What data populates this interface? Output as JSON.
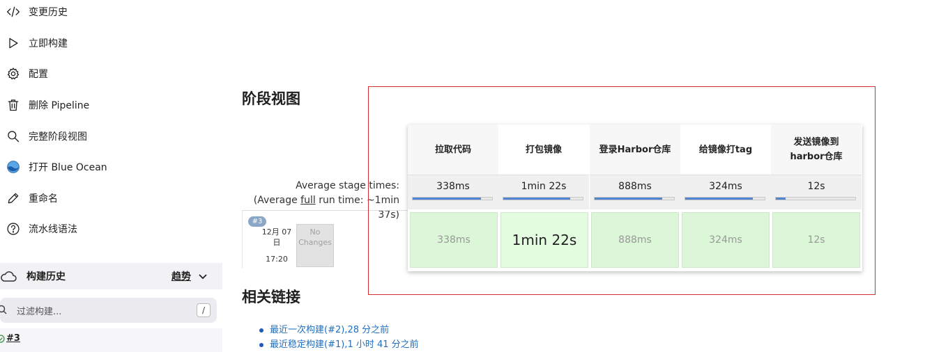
{
  "sidebar": {
    "items": [
      {
        "label": "变更历史",
        "icon": "code-icon"
      },
      {
        "label": "立即构建",
        "icon": "play-icon"
      },
      {
        "label": "配置",
        "icon": "gear-icon"
      },
      {
        "label": "删除 Pipeline",
        "icon": "trash-icon"
      },
      {
        "label": "完整阶段视图",
        "icon": "search-icon"
      },
      {
        "label": "打开 Blue Ocean",
        "icon": "blue-ocean-icon"
      },
      {
        "label": "重命名",
        "icon": "pencil-icon"
      },
      {
        "label": "流水线语法",
        "icon": "help-icon"
      }
    ]
  },
  "build_history": {
    "title": "构建历史",
    "trend_label": "趋势",
    "filter_placeholder": "过滤构建...",
    "filter_shortcut": "/",
    "builds": [
      {
        "number": "#3"
      }
    ]
  },
  "stage_view": {
    "title": "阶段视图",
    "avg_label_line1": "Average stage times:",
    "avg_label_pre": "(Average ",
    "avg_label_full": "full",
    "avg_label_post": " run time: ~1min 37s)",
    "build": {
      "badge": "#3",
      "date": "12月 07 日",
      "time": "17:20",
      "changes": "No Changes"
    },
    "stages": [
      {
        "name": "拉取代码",
        "avg": "338ms",
        "run": "338ms",
        "bar_fraction": 0.86
      },
      {
        "name": "打包镜像",
        "avg": "1min 22s",
        "run": "1min 22s",
        "bar_fraction": 0.84
      },
      {
        "name": "登录Harbor仓库",
        "avg": "888ms",
        "run": "888ms",
        "bar_fraction": 0.85
      },
      {
        "name": "给镜像打tag",
        "avg": "324ms",
        "run": "324ms",
        "bar_fraction": 0.85
      },
      {
        "name": "发送镜像到harbor仓库",
        "avg": "12s",
        "run": "12s",
        "bar_fraction": 0.12
      }
    ],
    "highlight_color": "#d32f2f"
  },
  "related_links": {
    "title": "相关链接",
    "items": [
      "最近一次构建(#2),28 分之前",
      "最近稳定构建(#1),1 小时 41 分之前"
    ]
  }
}
